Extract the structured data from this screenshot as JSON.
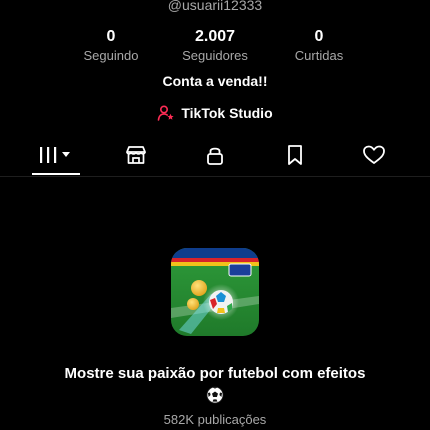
{
  "profile": {
    "username": "@usuarii12333",
    "bio": "Conta a venda!!"
  },
  "stats": [
    {
      "value": "0",
      "label": "Seguindo"
    },
    {
      "value": "2.007",
      "label": "Seguidores"
    },
    {
      "value": "0",
      "label": "Curtidas"
    }
  ],
  "studio": {
    "label": "TikTok Studio",
    "icon": "person-star-icon",
    "accent": "#fe2c55"
  },
  "tabs": [
    {
      "name": "videos-grid",
      "icon": "grid-bars-icon",
      "active": true
    },
    {
      "name": "shop",
      "icon": "store-icon",
      "active": false
    },
    {
      "name": "private",
      "icon": "lock-icon",
      "active": false
    },
    {
      "name": "favorites",
      "icon": "bookmark-icon",
      "active": false
    },
    {
      "name": "liked",
      "icon": "heart-icon",
      "active": false
    }
  ],
  "effect": {
    "icon": "fifa-football-effect-icon",
    "title": "Mostre sua paixão por futebol com efeitos",
    "emoji": "soccer-ball-icon",
    "count": "582K publicações"
  },
  "colors": {
    "background": "#000000",
    "text": "#ffffff",
    "muted": "#a8a8a8",
    "accent": "#fe2c55"
  }
}
